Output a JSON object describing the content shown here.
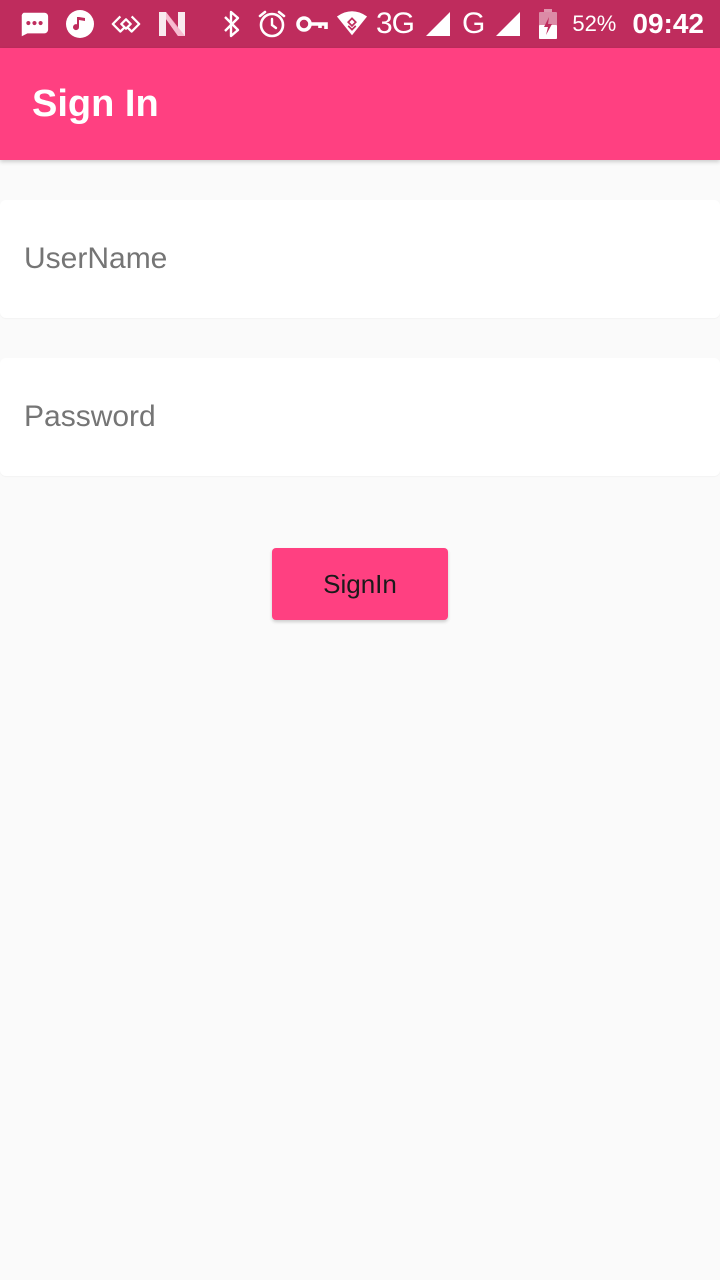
{
  "status_bar": {
    "icons_left": [
      "chat-bubble-icon",
      "music-note-icon",
      "link-icon",
      "n-logo-icon"
    ],
    "icons_right": [
      "bluetooth-icon",
      "alarm-icon",
      "key-icon",
      "wifi-icon",
      "signal-icon",
      "battery-icon"
    ],
    "network_primary": "3G",
    "network_secondary": "G",
    "battery_percent": "52%",
    "time": "09:42",
    "background_color": "#bf2c5d"
  },
  "app_bar": {
    "title": "Sign In",
    "background_color": "#ff4081"
  },
  "form": {
    "username": {
      "placeholder": "UserName",
      "value": ""
    },
    "password": {
      "placeholder": "Password",
      "value": ""
    },
    "submit_label": "SignIn",
    "accent_color": "#ff4081"
  }
}
